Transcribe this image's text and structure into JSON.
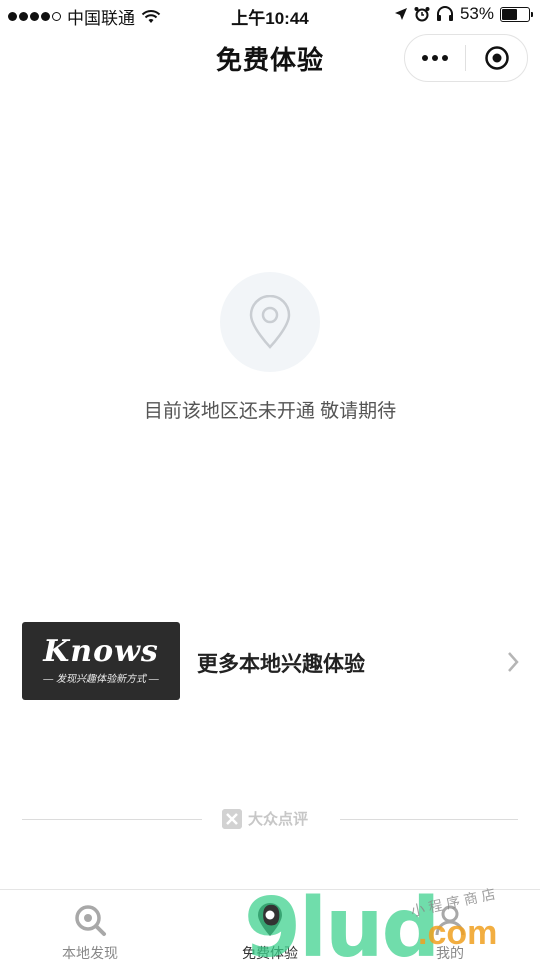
{
  "status_bar": {
    "carrier": "中国联通",
    "time": "上午10:44",
    "battery": "53%"
  },
  "nav": {
    "title": "免费体验"
  },
  "empty_state": {
    "icon": "location-pin-icon",
    "message": "目前该地区还未开通 敬请期待"
  },
  "banner": {
    "logo_brand": "Knows",
    "logo_tagline": "— 发现兴趣体验新方式 —",
    "label": "更多本地兴趣体验"
  },
  "footer": {
    "brand": "大众点评"
  },
  "tabs": [
    {
      "label": "本地发现",
      "icon": "search-icon",
      "active": false
    },
    {
      "label": "免费体验",
      "icon": "location-pin-icon",
      "active": true
    },
    {
      "label": "我的",
      "icon": "user-icon",
      "active": false
    }
  ],
  "watermark": {
    "main": "9lud",
    "suffix": ".com",
    "small": "小程序商店"
  },
  "colors": {
    "watermark_green": "#3ad08b",
    "watermark_orange": "#f0a020",
    "logo_bg": "#2c2c2c"
  }
}
